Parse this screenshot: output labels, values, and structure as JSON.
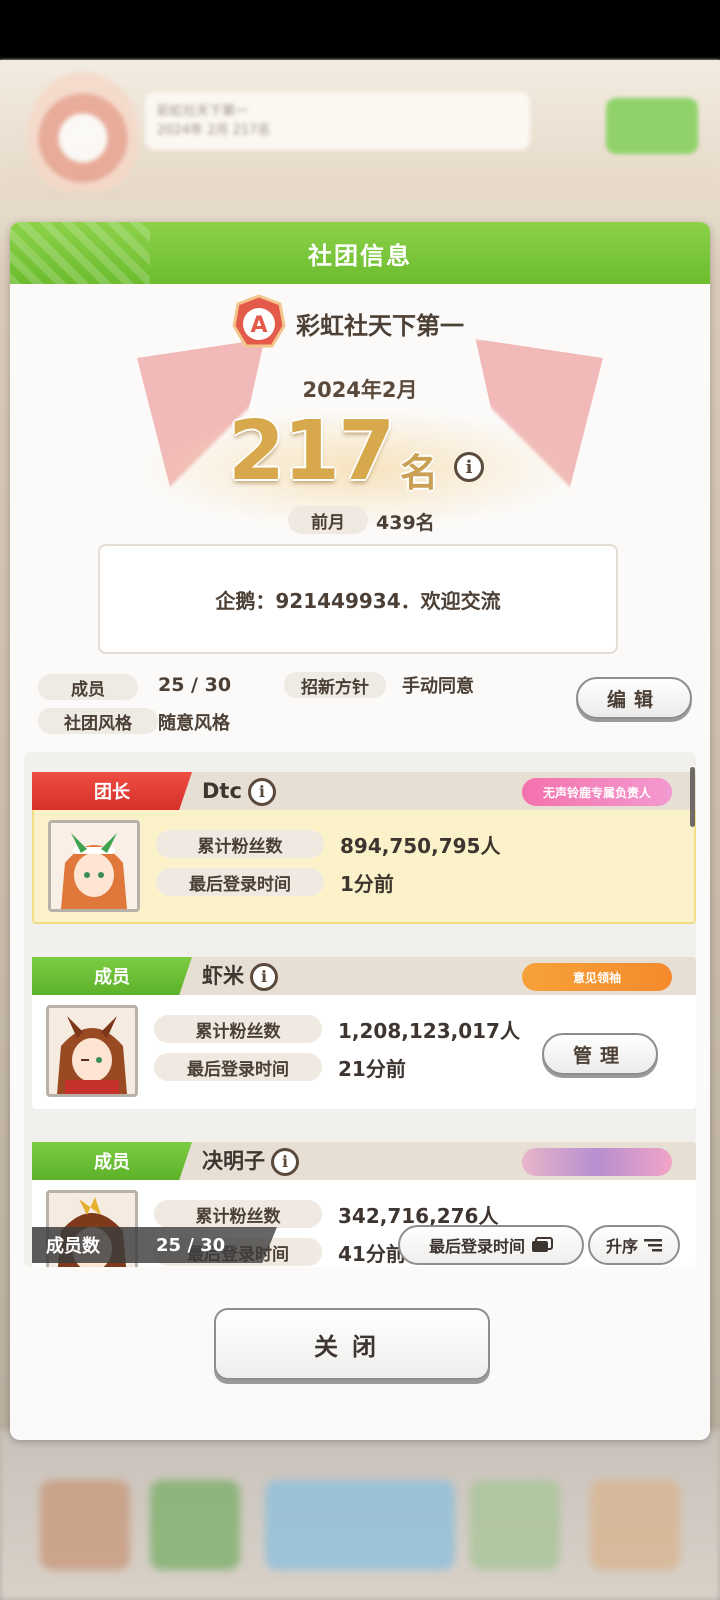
{
  "background": {
    "club_name_blurred": "彩虹社天下第一",
    "club_sub_blurred": "2024年 2月 217名"
  },
  "dialog": {
    "title": "社团信息",
    "club_name": "彩虹社天下第一",
    "rank_date": "2024年2月",
    "rank_number": "217",
    "rank_unit": "名",
    "prev_label": "前月",
    "prev_value": "439名",
    "description": "企鹅：921449934．欢迎交流",
    "members_label": "成员",
    "members_value": "25 / 30",
    "recruit_label": "招新方针",
    "recruit_value": "手动同意",
    "style_label": "社团风格",
    "style_value": "随意风格",
    "edit_label": "编辑"
  },
  "members": [
    {
      "role": "团长",
      "name": "Dtc",
      "badge": "无声铃鹿专属负责人",
      "fans_label": "累计粉丝数",
      "fans_value": "894,750,795人",
      "login_label": "最后登录时间",
      "login_value": "1分前"
    },
    {
      "role": "成员",
      "name": "虾米",
      "badge": "意见领袖",
      "fans_label": "累计粉丝数",
      "fans_value": "1,208,123,017人",
      "login_label": "最后登录时间",
      "login_value": "21分前",
      "manage_label": "管理"
    },
    {
      "role": "成员",
      "name": "决明子",
      "badge": "",
      "fans_label": "累计粉丝数",
      "fans_value": "342,716,276人",
      "login_label": "最后登录时间",
      "login_value": "41分前"
    }
  ],
  "footer": {
    "count_label": "成员数",
    "count_value": "25 / 30",
    "sort_field": "最后登录时间",
    "sort_order": "升序"
  },
  "close_label": "关闭",
  "colors": {
    "header_green": "#7cc63b",
    "leader_red": "#e2453c",
    "member_green": "#6cbf33",
    "leader_bg": "#fbf2c9"
  }
}
